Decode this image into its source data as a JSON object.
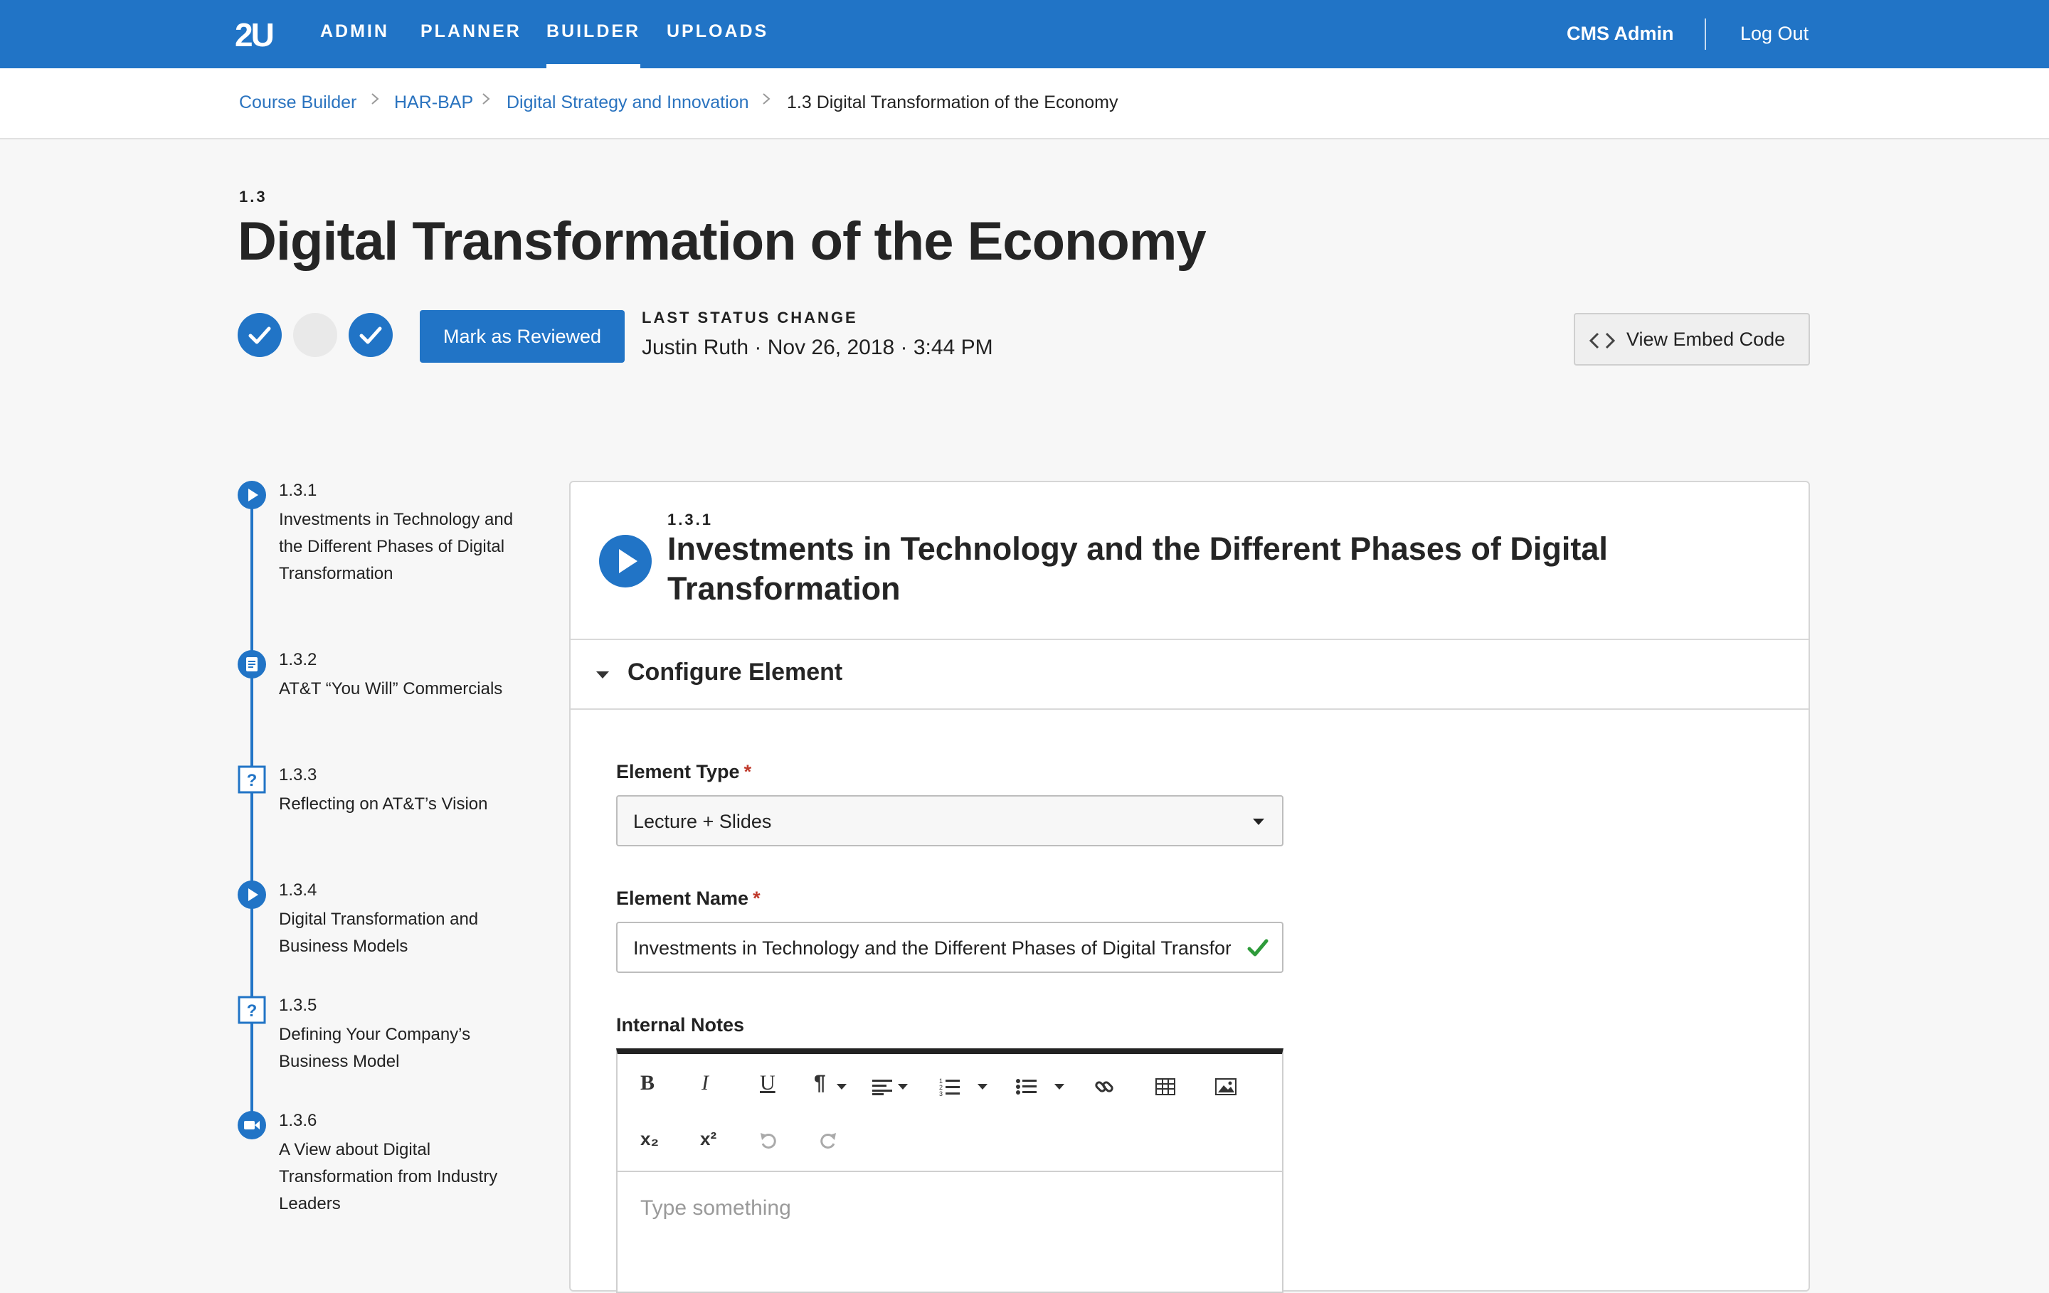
{
  "nav": {
    "logo": "2U",
    "items": [
      {
        "label": "ADMIN"
      },
      {
        "label": "PLANNER"
      },
      {
        "label": "BUILDER",
        "active": true
      },
      {
        "label": "UPLOADS"
      }
    ],
    "user": "CMS Admin",
    "logout": "Log Out"
  },
  "breadcrumb": [
    {
      "label": "Course Builder"
    },
    {
      "label": "HAR-BAP"
    },
    {
      "label": "Digital Strategy and Innovation"
    },
    {
      "label": "1.3 Digital Transformation of the Economy"
    }
  ],
  "page": {
    "number": "1.3",
    "title": "Digital Transformation of the Economy",
    "status_steps": [
      "done",
      "pending",
      "done"
    ],
    "mark_reviewed": "Mark as Reviewed",
    "status_label": "LAST STATUS CHANGE",
    "status_value": "Justin Ruth · Nov 26, 2018 · 3:44 PM",
    "embed_button": "View Embed Code"
  },
  "sidebar": {
    "items": [
      {
        "num": "1.3.1",
        "label": "Investments in Technology and the Different Phases of Digital Transformation",
        "icon": "play-icon"
      },
      {
        "num": "1.3.2",
        "label": "AT&T “You Will” Commercials",
        "icon": "document-icon"
      },
      {
        "num": "1.3.3",
        "label": "Reflecting on AT&T’s Vision",
        "icon": "question-icon"
      },
      {
        "num": "1.3.4",
        "label": "Digital Transformation and Business Models",
        "icon": "play-icon"
      },
      {
        "num": "1.3.5",
        "label": "Defining Your Company’s Business Model",
        "icon": "question-icon"
      },
      {
        "num": "1.3.6",
        "label": "A View about Digital Transformation from Industry Leaders",
        "icon": "video-icon"
      }
    ]
  },
  "element": {
    "number": "1.3.1",
    "title": "Investments in Technology and the Different Phases of Digital Transformation",
    "section": "Configure Element",
    "type_label": "Element Type",
    "type_value": "Lecture + Slides",
    "name_label": "Element Name",
    "name_value": "Investments in Technology and the Different Phases of Digital Transformation",
    "notes_label": "Internal Notes",
    "notes_placeholder": "Type something",
    "required_mark": "*"
  },
  "toolbar": {
    "bold": "B",
    "italic": "I",
    "underline": "U",
    "paragraph": "¶",
    "subscript": "x₂",
    "superscript": "x²"
  },
  "colors": {
    "primary": "#2174c6",
    "link": "#2a73bf",
    "success": "#2e9b3a",
    "required": "#c0392b"
  }
}
